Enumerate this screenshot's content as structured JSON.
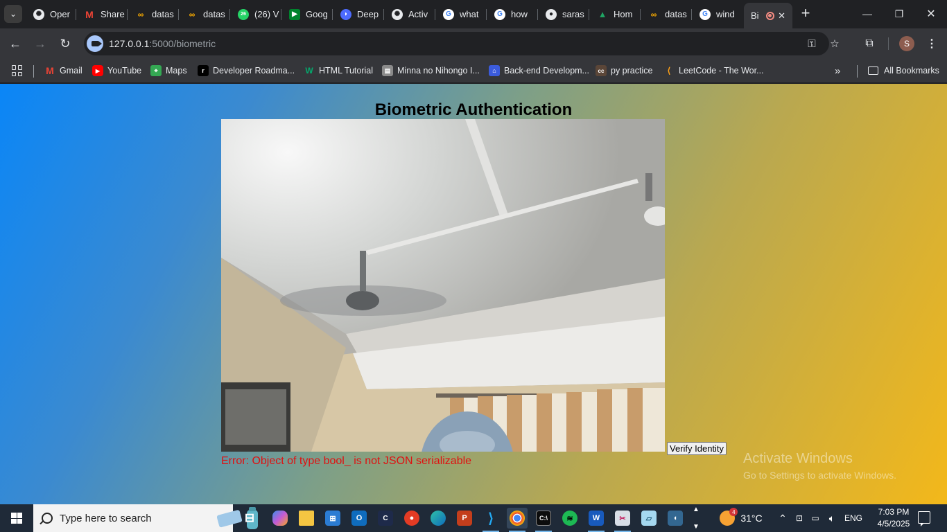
{
  "tabs": [
    {
      "title": "Oper",
      "icon": "openai-icon",
      "color": "#e8eaed"
    },
    {
      "title": "Share",
      "icon": "gmail-icon",
      "color": "#ea4335"
    },
    {
      "title": "datas",
      "icon": "colab-icon",
      "color": "#f9ab00"
    },
    {
      "title": "datas",
      "icon": "colab-icon",
      "color": "#f9ab00"
    },
    {
      "title": "(26) V",
      "icon": "whatsapp-icon",
      "color": "#25d366"
    },
    {
      "title": "Goog",
      "icon": "google-meet-icon",
      "color": "#00832d"
    },
    {
      "title": "Deep",
      "icon": "deepseek-icon",
      "color": "#4d6bfe"
    },
    {
      "title": "Activ",
      "icon": "openai-icon",
      "color": "#e8eaed"
    },
    {
      "title": "what",
      "icon": "google-icon",
      "color": "#4285f4"
    },
    {
      "title": "how",
      "icon": "google-icon",
      "color": "#4285f4"
    },
    {
      "title": "saras",
      "icon": "github-icon",
      "color": "#e8eaed"
    },
    {
      "title": "Hom",
      "icon": "google-drive-icon",
      "color": "#1fa463"
    },
    {
      "title": "datas",
      "icon": "colab-icon",
      "color": "#f9ab00"
    },
    {
      "title": "wind",
      "icon": "google-icon",
      "color": "#4285f4"
    }
  ],
  "active_tab": {
    "title": "Bi"
  },
  "address_bar": {
    "host": "127.0.0.1",
    "path": ":5000/biometric"
  },
  "profile": {
    "initial": "S"
  },
  "bookmarks": [
    {
      "label": "Gmail",
      "icon": "gmail-icon",
      "color": "#ea4335"
    },
    {
      "label": "YouTube",
      "icon": "youtube-icon",
      "color": "#ff0000"
    },
    {
      "label": "Maps",
      "icon": "maps-icon",
      "color": "#34a853"
    },
    {
      "label": "Developer Roadma...",
      "icon": "roadmap-icon",
      "color": "#000000"
    },
    {
      "label": "HTML Tutorial",
      "icon": "w3schools-icon",
      "color": "#04aa6d"
    },
    {
      "label": "Minna no Nihongo I...",
      "icon": "book-icon",
      "color": "#8a8a8a"
    },
    {
      "label": "Back-end Developm...",
      "icon": "bookmark-site-icon",
      "color": "#3b5bdb"
    },
    {
      "label": "py practice",
      "icon": "codechef-icon",
      "color": "#5b4638"
    },
    {
      "label": "LeetCode - The Wor...",
      "icon": "leetcode-icon",
      "color": "#ffa116"
    }
  ],
  "all_bookmarks_label": "All Bookmarks",
  "page": {
    "title": "Biometric Authentication",
    "verify_button": "Verify Identity",
    "error": "Error: Object of type bool_ is not JSON serializable"
  },
  "watermark": {
    "line1": "Activate Windows",
    "line2": "Go to Settings to activate Windows."
  },
  "taskbar": {
    "search_placeholder": "Type here to search",
    "weather": "31°C",
    "weather_badge": "4",
    "language": "ENG",
    "time": "7:03 PM",
    "date": "4/5/2025"
  }
}
